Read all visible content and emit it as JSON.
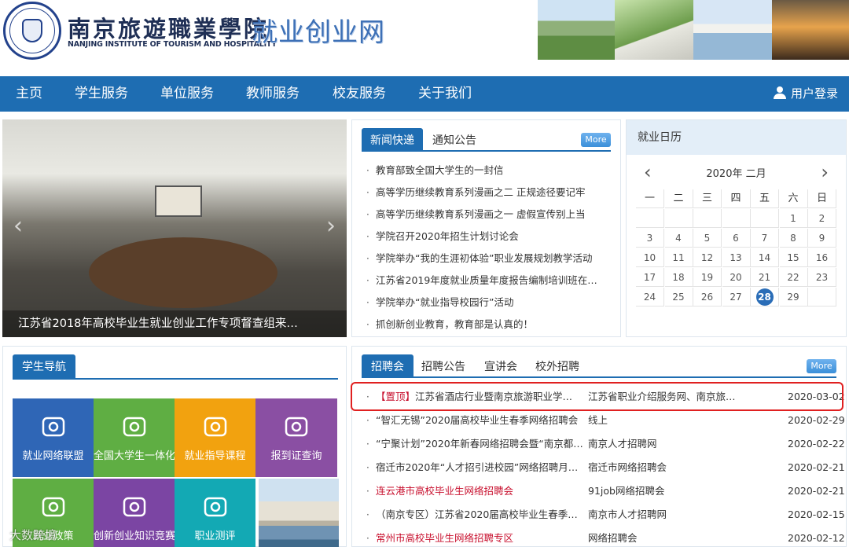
{
  "header": {
    "school_name_cn": "南京旅遊職業學院",
    "school_name_en": "NANJING INSTITUTE OF TOURISM AND HOSPITALITY",
    "site_title": "就业创业网"
  },
  "nav": {
    "items": [
      "主页",
      "学生服务",
      "单位服务",
      "教师服务",
      "校友服务",
      "关于我们"
    ],
    "login": "用户登录"
  },
  "hero": {
    "caption": "江苏省2018年高校毕业生就业创业工作专项督查组来…"
  },
  "news": {
    "tabs": [
      "新闻快递",
      "通知公告"
    ],
    "more": "More",
    "items": [
      "教育部致全国大学生的一封信",
      "高等学历继续教育系列漫画之二 正规途径要记牢",
      "高等学历继续教育系列漫画之一 虚假宣传别上当",
      "学院召开2020年招生计划讨论会",
      "学院举办“我的生涯初体验”职业发展规划教学活动",
      "江苏省2019年度就业质量年度报告编制培训班在…",
      "学院举办“就业指导校园行”活动",
      "抓创新创业教育，教育部是认真的！"
    ]
  },
  "calendar": {
    "title": "就业日历",
    "month_label": "2020年 二月",
    "weekdays": [
      "一",
      "二",
      "三",
      "四",
      "五",
      "六",
      "日"
    ],
    "days": [
      [
        "",
        "",
        "",
        "",
        "",
        "1",
        "2"
      ],
      [
        "3",
        "4",
        "5",
        "6",
        "7",
        "8",
        "9"
      ],
      [
        "10",
        "11",
        "12",
        "13",
        "14",
        "15",
        "16"
      ],
      [
        "17",
        "18",
        "19",
        "20",
        "21",
        "22",
        "23"
      ],
      [
        "24",
        "25",
        "26",
        "27",
        "28",
        "29",
        ""
      ]
    ],
    "today": "28"
  },
  "student_nav": {
    "title": "学生导航",
    "tiles": [
      {
        "label": "就业网络联盟",
        "color": "#2f66b6",
        "icon": "network-icon"
      },
      {
        "label": "全国大学生一体化",
        "color": "#5fae43",
        "icon": "swirl-logo-icon"
      },
      {
        "label": "就业指导课程",
        "color": "#f2a20f",
        "icon": "course-screen-icon"
      },
      {
        "label": "报到证查询",
        "color": "#8a4fa3",
        "icon": "document-search-icon"
      },
      {
        "label": "就业政策",
        "color": "#5fae43",
        "icon": "magnifier-icon"
      },
      {
        "label": "创新创业知识竞赛",
        "color": "#7b45a3",
        "icon": "graduation-cap-icon"
      },
      {
        "label": "职业测评",
        "color": "#13a9b4",
        "icon": "clipboard-icon"
      }
    ],
    "watermark": "大数跨境"
  },
  "recruit": {
    "tabs": [
      "招聘会",
      "招聘公告",
      "宣讲会",
      "校外招聘"
    ],
    "more": "More",
    "rows": [
      {
        "pin": "【置顶】",
        "title": "江苏省酒店行业暨南京旅游职业学…",
        "source": "江苏省职业介绍服务网、南京旅…",
        "date": "2020-03-02"
      },
      {
        "pin": "",
        "title": "“智汇无锡”2020届高校毕业生春季网络招聘会",
        "source": "线上",
        "date": "2020-02-29"
      },
      {
        "pin": "",
        "title": "“宁聚计划”2020年新春网络招聘会暨“南京都…",
        "source": "南京人才招聘网",
        "date": "2020-02-22"
      },
      {
        "pin": "",
        "title": "宿迁市2020年“人才招引进校园”网络招聘月…",
        "source": "宿迁市网络招聘会",
        "date": "2020-02-21"
      },
      {
        "pin": "",
        "title": "连云港市高校毕业生网络招聘会",
        "source": "91job网络招聘会",
        "date": "2020-02-21",
        "red": true
      },
      {
        "pin": "",
        "title": "（南京专区）江苏省2020届高校毕业生春季…",
        "source": "南京市人才招聘网",
        "date": "2020-02-15"
      },
      {
        "pin": "",
        "title": "常州市高校毕业生网络招聘专区",
        "source": "网络招聘会",
        "date": "2020-02-12",
        "red": true
      }
    ]
  }
}
